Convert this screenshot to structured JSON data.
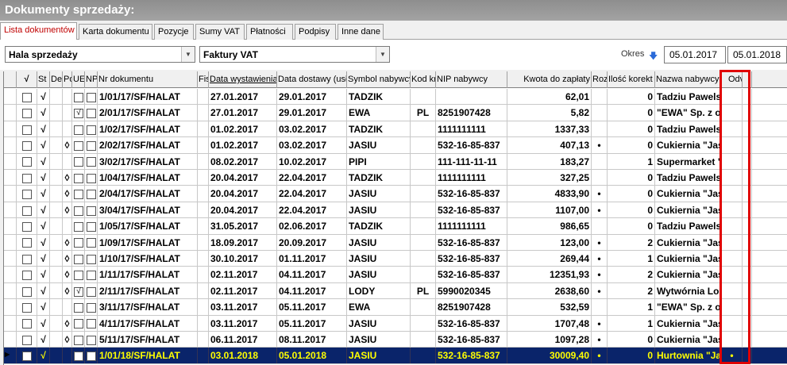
{
  "title": "Dokumenty sprzedaży:",
  "tabs": [
    {
      "label": "Lista dokumentów",
      "active": true
    },
    {
      "label": "Karta dokumentu"
    },
    {
      "label": "Pozycje"
    },
    {
      "label": "Sumy VAT"
    },
    {
      "label": "Płatności"
    },
    {
      "label": "Podpisy"
    },
    {
      "label": "Inne dane"
    }
  ],
  "filters": {
    "location": "Hala sprzedaży",
    "doc_type": "Faktury VAT",
    "okres_label": "Okres",
    "date_from": "05.01.2017",
    "date_to": "05.01.2018"
  },
  "columns": {
    "check": "√",
    "st": "St",
    "de": "De",
    "po": "Po",
    "ue": "UE",
    "np": "NP",
    "nr": "Nr dokumentu",
    "fis": "Fis",
    "data_wyst": "Data wystawienia",
    "data_dost": "Data dostawy (usł",
    "symbol": "Symbol nabywcy",
    "kod": "Kod kr",
    "nip": "NIP nabywcy",
    "kwota": "Kwota do zapłaty",
    "rozl": "Rozl",
    "ilosc": "Ilość korekt",
    "nazwa": "Nazwa nabywcy",
    "odv": "Odv"
  },
  "rows": [
    {
      "st": "√",
      "po": "",
      "ue": "",
      "np": "",
      "nr": "1/01/17/SF/HALAT",
      "wyst": "27.01.2017",
      "dost": "29.01.2017",
      "symbol": "TADZIK",
      "kod": "",
      "nip": "",
      "kwota": "62,01",
      "rozl": "",
      "ilosc": "0",
      "nazwa": "Tadziu Pawelski",
      "odv": ""
    },
    {
      "st": "√",
      "po": "",
      "ue": "√",
      "np": "",
      "nr": "2/01/17/SF/HALAT",
      "wyst": "27.01.2017",
      "dost": "29.01.2017",
      "symbol": "EWA",
      "kod": "PL",
      "nip": "8251907428",
      "kwota": "5,82",
      "rozl": "",
      "ilosc": "0",
      "nazwa": "\"EWA\" Sp. z o.",
      "odv": ""
    },
    {
      "st": "√",
      "po": "",
      "ue": "",
      "np": "",
      "nr": "1/02/17/SF/HALAT",
      "wyst": "01.02.2017",
      "dost": "03.02.2017",
      "symbol": "TADZIK",
      "kod": "",
      "nip": "1111111111",
      "kwota": "1337,33",
      "rozl": "",
      "ilosc": "0",
      "nazwa": "Tadziu Pawelski",
      "odv": ""
    },
    {
      "st": "√",
      "po": "◊",
      "ue": "",
      "np": "",
      "nr": "2/02/17/SF/HALAT",
      "wyst": "01.02.2017",
      "dost": "03.02.2017",
      "symbol": "JASIU",
      "kod": "",
      "nip": "532-16-85-837",
      "kwota": "407,13",
      "rozl": "•",
      "ilosc": "0",
      "nazwa": "Cukiernia \"Jaś i",
      "odv": ""
    },
    {
      "st": "√",
      "po": "",
      "ue": "",
      "np": "",
      "nr": "3/02/17/SF/HALAT",
      "wyst": "08.02.2017",
      "dost": "10.02.2017",
      "symbol": "PIPI",
      "kod": "",
      "nip": "111-111-11-11",
      "kwota": "183,27",
      "rozl": "",
      "ilosc": "1",
      "nazwa": "Supermarket \"P",
      "odv": ""
    },
    {
      "st": "√",
      "po": "◊",
      "ue": "",
      "np": "",
      "nr": "1/04/17/SF/HALAT",
      "wyst": "20.04.2017",
      "dost": "22.04.2017",
      "symbol": "TADZIK",
      "kod": "",
      "nip": "1111111111",
      "kwota": "327,25",
      "rozl": "",
      "ilosc": "0",
      "nazwa": "Tadziu Pawelski",
      "odv": ""
    },
    {
      "st": "√",
      "po": "◊",
      "ue": "",
      "np": "",
      "nr": "2/04/17/SF/HALAT",
      "wyst": "20.04.2017",
      "dost": "22.04.2017",
      "symbol": "JASIU",
      "kod": "",
      "nip": "532-16-85-837",
      "kwota": "4833,90",
      "rozl": "•",
      "ilosc": "0",
      "nazwa": "Cukiernia \"Jaś i",
      "odv": ""
    },
    {
      "st": "√",
      "po": "◊",
      "ue": "",
      "np": "",
      "nr": "3/04/17/SF/HALAT",
      "wyst": "20.04.2017",
      "dost": "22.04.2017",
      "symbol": "JASIU",
      "kod": "",
      "nip": "532-16-85-837",
      "kwota": "1107,00",
      "rozl": "•",
      "ilosc": "0",
      "nazwa": "Cukiernia \"Jaś i",
      "odv": ""
    },
    {
      "st": "√",
      "po": "",
      "ue": "",
      "np": "",
      "nr": "1/05/17/SF/HALAT",
      "wyst": "31.05.2017",
      "dost": "02.06.2017",
      "symbol": "TADZIK",
      "kod": "",
      "nip": "1111111111",
      "kwota": "986,65",
      "rozl": "",
      "ilosc": "0",
      "nazwa": "Tadziu Pawelski",
      "odv": ""
    },
    {
      "st": "√",
      "po": "◊",
      "ue": "",
      "np": "",
      "nr": "1/09/17/SF/HALAT",
      "wyst": "18.09.2017",
      "dost": "20.09.2017",
      "symbol": "JASIU",
      "kod": "",
      "nip": "532-16-85-837",
      "kwota": "123,00",
      "rozl": "•",
      "ilosc": "2",
      "nazwa": "Cukiernia \"Jaś i",
      "odv": ""
    },
    {
      "st": "√",
      "po": "◊",
      "ue": "",
      "np": "",
      "nr": "1/10/17/SF/HALAT",
      "wyst": "30.10.2017",
      "dost": "01.11.2017",
      "symbol": "JASIU",
      "kod": "",
      "nip": "532-16-85-837",
      "kwota": "269,44",
      "rozl": "•",
      "ilosc": "1",
      "nazwa": "Cukiernia \"Jaś i",
      "odv": ""
    },
    {
      "st": "√",
      "po": "◊",
      "ue": "",
      "np": "",
      "nr": "1/11/17/SF/HALAT",
      "wyst": "02.11.2017",
      "dost": "04.11.2017",
      "symbol": "JASIU",
      "kod": "",
      "nip": "532-16-85-837",
      "kwota": "12351,93",
      "rozl": "•",
      "ilosc": "2",
      "nazwa": "Cukiernia \"Jaś i",
      "odv": ""
    },
    {
      "st": "√",
      "po": "◊",
      "ue": "√",
      "np": "",
      "nr": "2/11/17/SF/HALAT",
      "wyst": "02.11.2017",
      "dost": "04.11.2017",
      "symbol": "LODY",
      "kod": "PL",
      "nip": "5990020345",
      "kwota": "2638,60",
      "rozl": "•",
      "ilosc": "2",
      "nazwa": "Wytwórnia Lodó",
      "odv": ""
    },
    {
      "st": "√",
      "po": "",
      "ue": "",
      "np": "",
      "nr": "3/11/17/SF/HALAT",
      "wyst": "03.11.2017",
      "dost": "05.11.2017",
      "symbol": "EWA",
      "kod": "",
      "nip": "8251907428",
      "kwota": "532,59",
      "rozl": "",
      "ilosc": "1",
      "nazwa": "\"EWA\" Sp. z o.",
      "odv": ""
    },
    {
      "st": "√",
      "po": "◊",
      "ue": "",
      "np": "",
      "nr": "4/11/17/SF/HALAT",
      "wyst": "03.11.2017",
      "dost": "05.11.2017",
      "symbol": "JASIU",
      "kod": "",
      "nip": "532-16-85-837",
      "kwota": "1707,48",
      "rozl": "•",
      "ilosc": "1",
      "nazwa": "Cukiernia \"Jaś i",
      "odv": ""
    },
    {
      "st": "√",
      "po": "◊",
      "ue": "",
      "np": "",
      "nr": "5/11/17/SF/HALAT",
      "wyst": "06.11.2017",
      "dost": "08.11.2017",
      "symbol": "JASIU",
      "kod": "",
      "nip": "532-16-85-837",
      "kwota": "1097,28",
      "rozl": "•",
      "ilosc": "0",
      "nazwa": "Cukiernia \"Jaś i",
      "odv": ""
    },
    {
      "st": "√",
      "po": "",
      "ue": "",
      "np": "",
      "nr": "1/01/18/SF/HALAT",
      "wyst": "03.01.2018",
      "dost": "05.01.2018",
      "symbol": "JASIU",
      "kod": "",
      "nip": "532-16-85-837",
      "kwota": "30009,40",
      "rozl": "•",
      "ilosc": "0",
      "nazwa": "Hurtownia \"Jaś i",
      "odv": "•",
      "selected": true
    }
  ]
}
